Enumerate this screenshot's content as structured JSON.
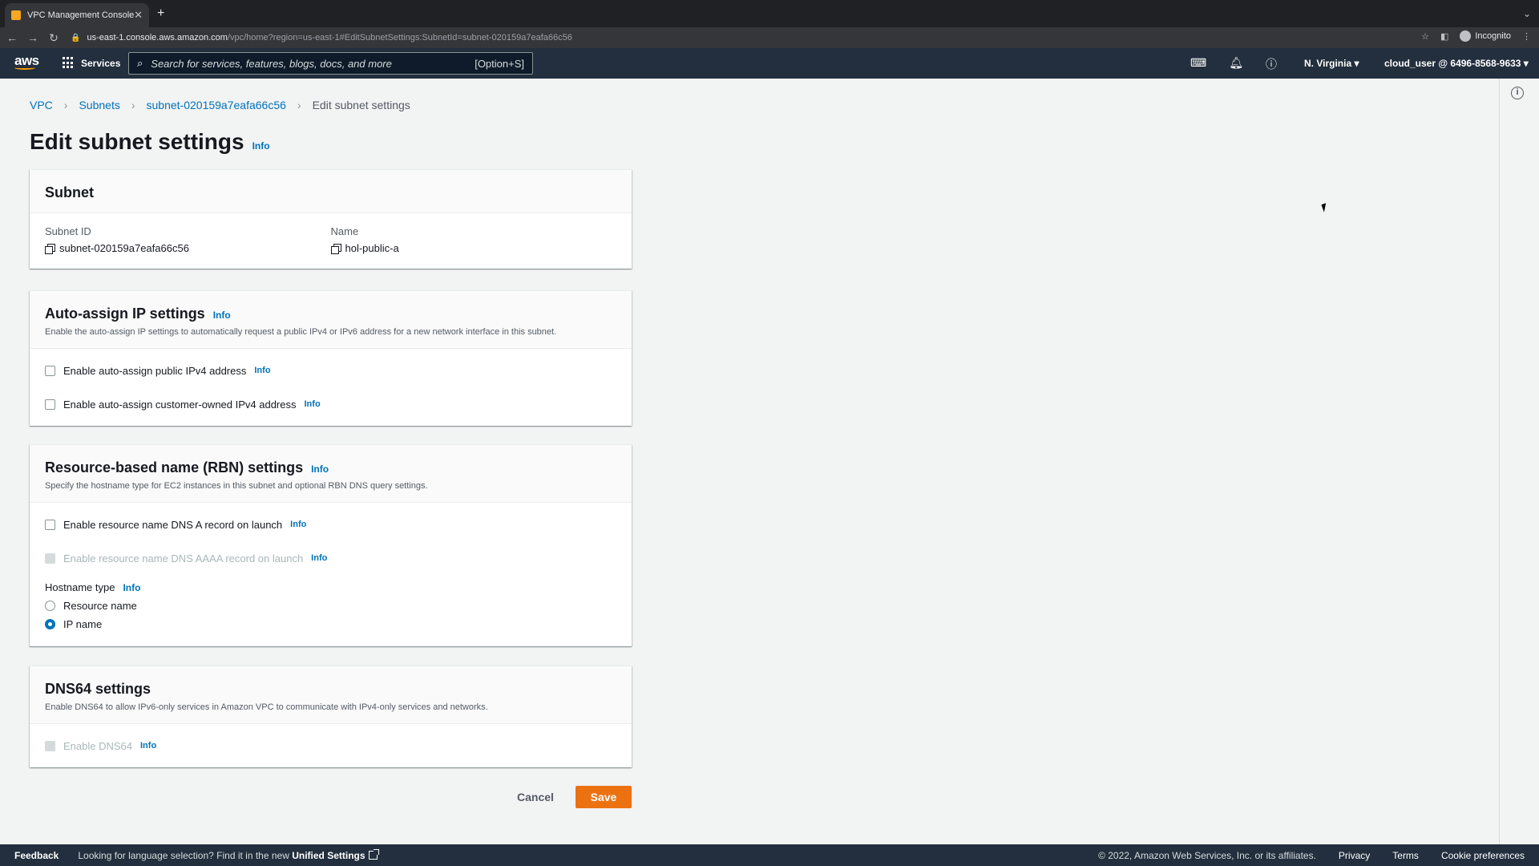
{
  "browser": {
    "tab_title": "VPC Management Console",
    "url_host": "us-east-1.console.aws.amazon.com",
    "url_path": "/vpc/home?region=us-east-1#EditSubnetSettings:SubnetId=subnet-020159a7eafa66c56",
    "incognito_label": "Incognito"
  },
  "awsnav": {
    "logo": "aws",
    "services_label": "Services",
    "search_placeholder": "Search for services, features, blogs, docs, and more",
    "search_shortcut": "[Option+S]",
    "region": "N. Virginia ▾",
    "account": "cloud_user @ 6496-8568-9633 ▾"
  },
  "breadcrumb": {
    "items": [
      "VPC",
      "Subnets",
      "subnet-020159a7eafa66c56"
    ],
    "current": "Edit subnet settings"
  },
  "page": {
    "title": "Edit subnet settings",
    "info": "Info"
  },
  "subnet_panel": {
    "title": "Subnet",
    "subnet_id_label": "Subnet ID",
    "subnet_id_value": "subnet-020159a7eafa66c56",
    "name_label": "Name",
    "name_value": "hol-public-a"
  },
  "auto_assign_panel": {
    "title": "Auto-assign IP settings",
    "info": "Info",
    "description": "Enable the auto-assign IP settings to automatically request a public IPv4 or IPv6 address for a new network interface in this subnet.",
    "options": [
      {
        "label": "Enable auto-assign public IPv4 address",
        "info": "Info",
        "checked": false,
        "disabled": false
      },
      {
        "label": "Enable auto-assign customer-owned IPv4 address",
        "info": "Info",
        "checked": false,
        "disabled": false
      }
    ]
  },
  "rbn_panel": {
    "title": "Resource-based name (RBN) settings",
    "info": "Info",
    "description": "Specify the hostname type for EC2 instances in this subnet and optional RBN DNS query settings.",
    "options": [
      {
        "label": "Enable resource name DNS A record on launch",
        "info": "Info",
        "checked": false,
        "disabled": false
      },
      {
        "label": "Enable resource name DNS AAAA record on launch",
        "info": "Info",
        "checked": false,
        "disabled": true
      }
    ],
    "hostname_label": "Hostname type",
    "hostname_info": "Info",
    "hostname_options": [
      "Resource name",
      "IP name"
    ],
    "hostname_selected": "IP name"
  },
  "dns64_panel": {
    "title": "DNS64 settings",
    "description": "Enable DNS64 to allow IPv6-only services in Amazon VPC to communicate with IPv4-only services and networks.",
    "option_label": "Enable DNS64",
    "option_info": "Info",
    "disabled": true
  },
  "actions": {
    "cancel": "Cancel",
    "save": "Save"
  },
  "footer": {
    "feedback": "Feedback",
    "lang_note": "Looking for language selection? Find it in the new",
    "unified_settings": "Unified Settings",
    "copyright": "© 2022, Amazon Web Services, Inc. or its affiliates.",
    "privacy": "Privacy",
    "terms": "Terms",
    "cookie": "Cookie preferences"
  },
  "colors": {
    "link": "#0073bb",
    "primary_button": "#ec7211",
    "nav_bg": "#232f3e"
  }
}
